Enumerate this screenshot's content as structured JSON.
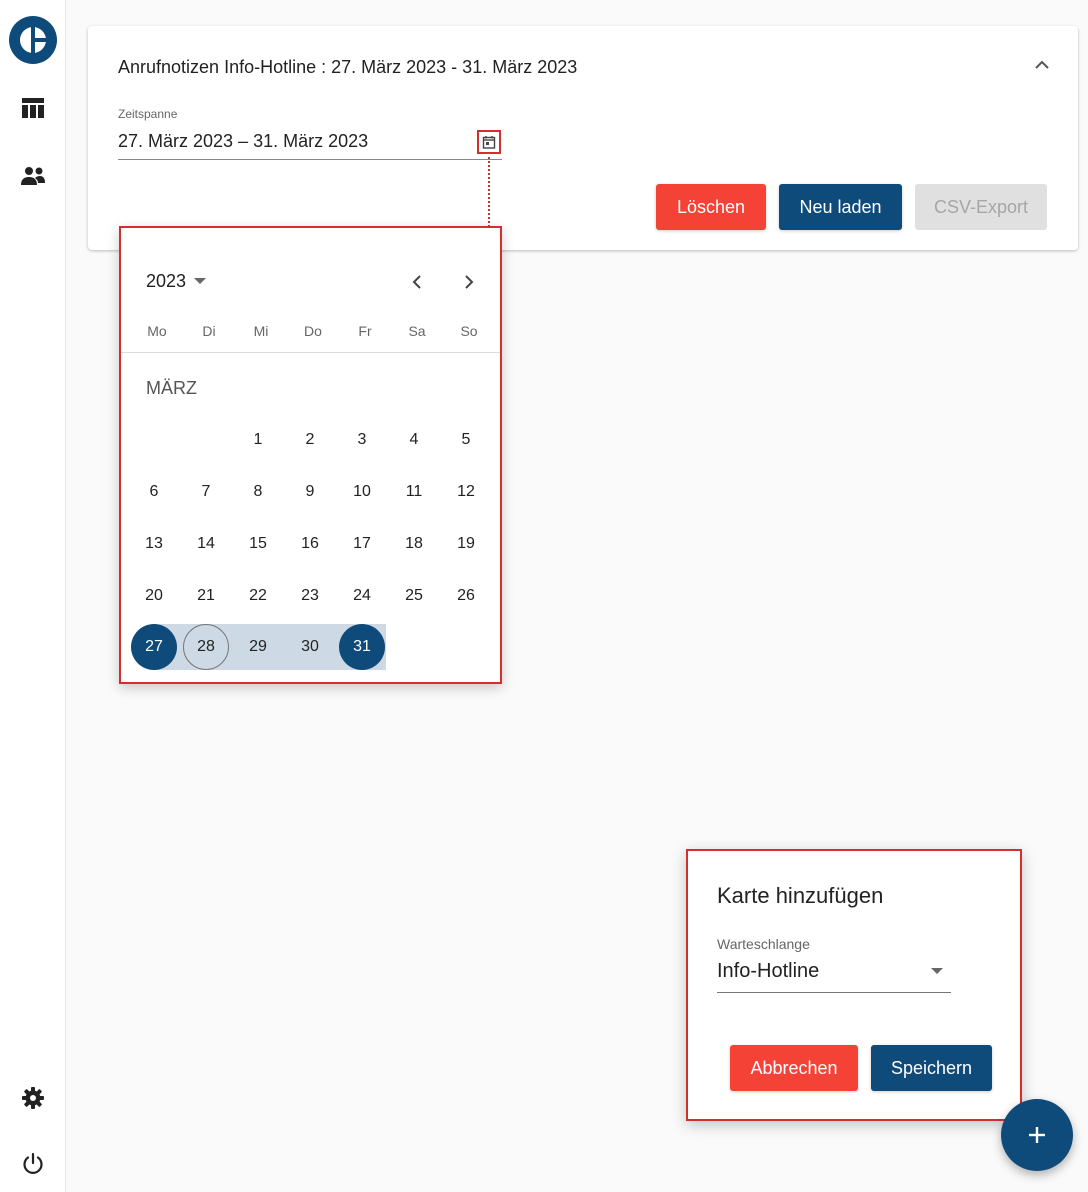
{
  "sidebar": {
    "logo": "app-logo",
    "items": [
      {
        "icon": "table-icon"
      },
      {
        "icon": "users-icon"
      }
    ],
    "bottom": [
      {
        "icon": "gear-icon"
      },
      {
        "icon": "power-icon"
      }
    ]
  },
  "card": {
    "title": "Anrufnotizen Info-Hotline : 27. März 2023 - 31. März 2023",
    "field_label": "Zeitspanne",
    "field_value": "27. März 2023 – 31. März 2023",
    "buttons": {
      "delete": "Löschen",
      "reload": "Neu laden",
      "export": "CSV-Export"
    }
  },
  "calendar": {
    "year": "2023",
    "weekdays": [
      "Mo",
      "Di",
      "Mi",
      "Do",
      "Fr",
      "Sa",
      "So"
    ],
    "month": "MÄRZ",
    "days": [
      "1",
      "2",
      "3",
      "4",
      "5",
      "6",
      "7",
      "8",
      "9",
      "10",
      "11",
      "12",
      "13",
      "14",
      "15",
      "16",
      "17",
      "18",
      "19",
      "20",
      "21",
      "22",
      "23",
      "24",
      "25",
      "26",
      "27",
      "28",
      "29",
      "30",
      "31"
    ],
    "range_start": "27",
    "range_end": "31",
    "today": "28"
  },
  "dialog": {
    "title": "Karte hinzufügen",
    "field_label": "Warteschlange",
    "field_value": "Info-Hotline",
    "cancel": "Abbrechen",
    "save": "Speichern"
  },
  "fab": {
    "label": "+"
  },
  "colors": {
    "primary": "#0e4a7a",
    "danger": "#f44336",
    "highlight": "#d32f2f",
    "range": "#cddae6"
  }
}
